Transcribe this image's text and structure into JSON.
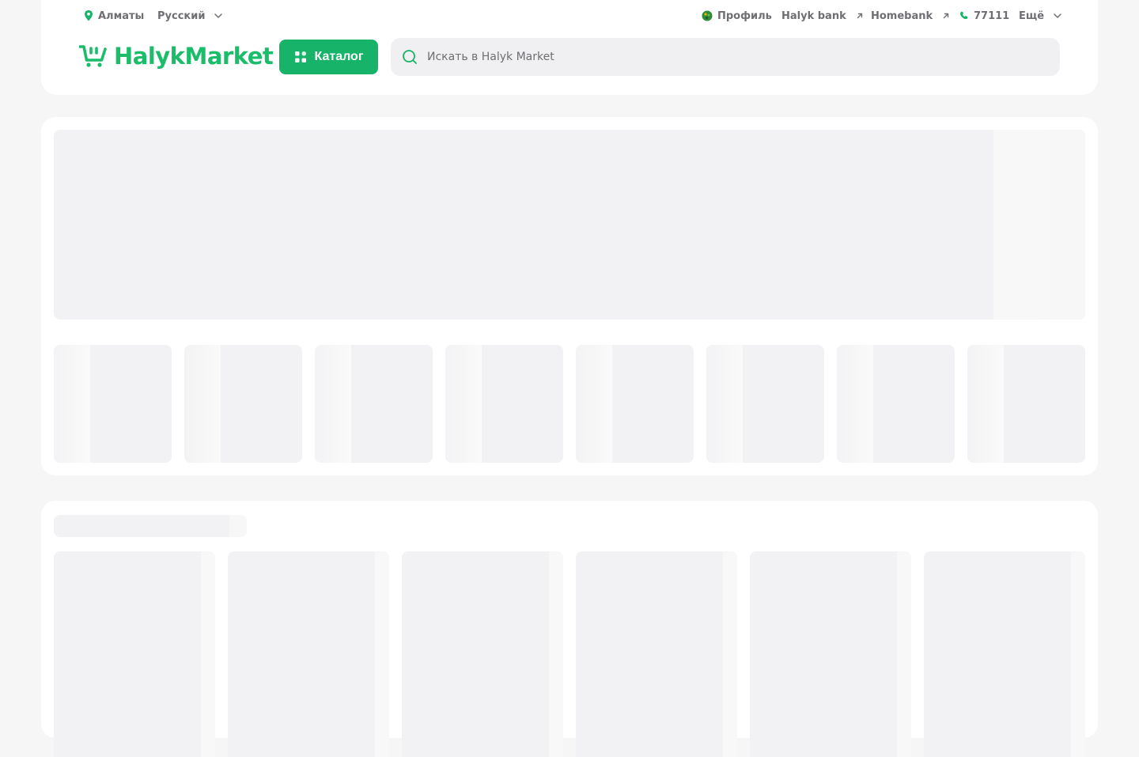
{
  "topbar": {
    "city": "Алматы",
    "language": "Русский",
    "profile": "Профиль",
    "halyk_bank": "Halyk bank",
    "homebank": "Homebank",
    "phone": "77111",
    "more": "Ещё"
  },
  "logo": {
    "text": "HalykMarket"
  },
  "catalog": {
    "label": "Каталог"
  },
  "search": {
    "placeholder": "Искать в Halyk Market"
  },
  "colors": {
    "brand": "#1bbd6a",
    "button": "#16b368",
    "skeleton": "#f2f2f4"
  },
  "icons": {
    "location": "location-pin-icon",
    "chevron": "chevron-down-icon",
    "profile": "profile-icon",
    "external": "external-link-icon",
    "phone": "phone-icon",
    "catalog": "grid-icon",
    "search": "search-icon",
    "cart": "cart-icon"
  }
}
